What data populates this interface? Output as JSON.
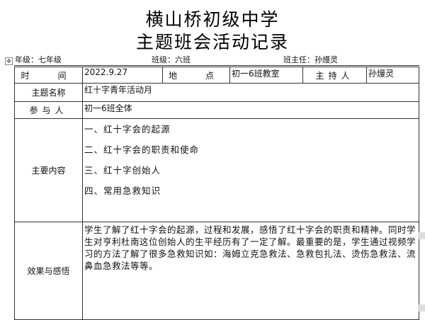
{
  "header": {
    "school": "横山桥初级中学",
    "record_title": "主题班会活动记录"
  },
  "info": {
    "grade": "年级：七年级",
    "class": "班级：六班",
    "teacher": "班主任：孙熳灵"
  },
  "table": {
    "time_label": "时　间",
    "time_value": "2022.9.27",
    "place_label": "地　点",
    "place_value": "初一6班教室",
    "host_label": "主持人",
    "host_value": "孙熳灵",
    "topic_label": "主题名称",
    "topic_value": "红十字青年活动月",
    "participants_label": "参与人",
    "participants_value": "初一6班全体",
    "content_label": "主要内容",
    "content_items": [
      "一、红十字会的起源",
      "二、红十字会的职责和使命",
      "三、红十字创始人",
      "四、常用急救知识"
    ],
    "effect_label": "效果与感悟",
    "effect_text": "学生了解了红十字会的起源，过程和发展，感悟了红十字会的职责和精神。同时学生对亨利杜南这位创始人的生平经历有了一定了解。最重要的是，学生通过视频学习的方法了解了很多急救知识如：海姆立克急救法、急救包扎法、烫伤急救法、流鼻血急救法等等。"
  }
}
